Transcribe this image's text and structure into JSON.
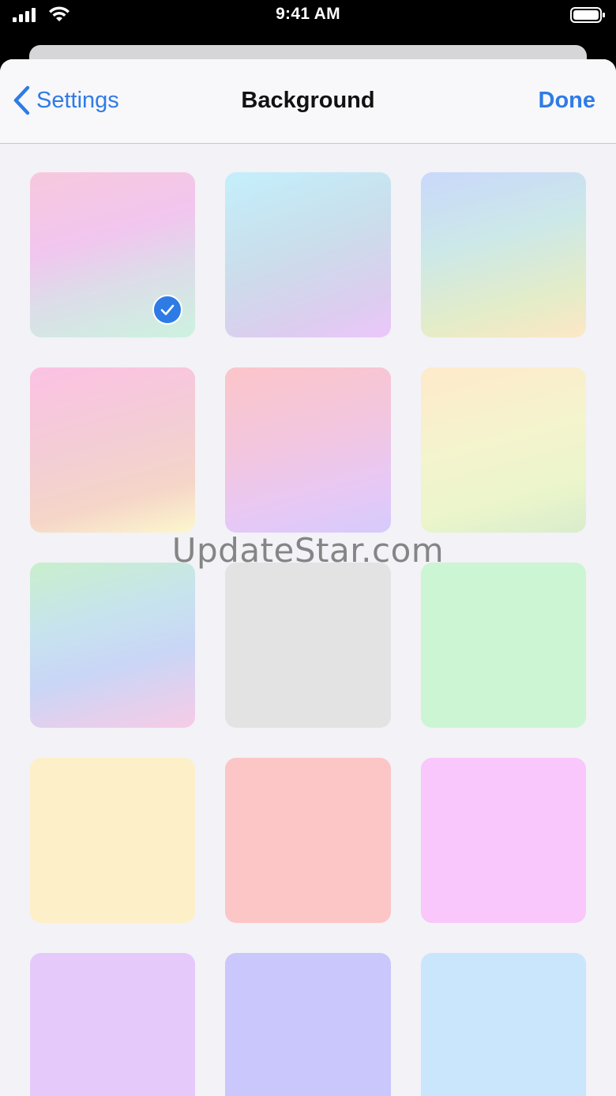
{
  "status_bar": {
    "time": "9:41 AM"
  },
  "nav": {
    "back_label": "Settings",
    "title": "Background",
    "done_label": "Done"
  },
  "accent_color": "#2f7be6",
  "swatches": [
    {
      "name": "gradient-pink-mint",
      "style": "linear-gradient(165deg, #f7c8dd 0%, #f1c6ef 40%, #dcdde8 65%, #cdf2df 100%)",
      "selected": true
    },
    {
      "name": "gradient-cyan-lavender",
      "style": "linear-gradient(160deg, #c4effc 0%, #cadeeb 45%, #dccdef 80%, #ecc6fb 100%)",
      "selected": false
    },
    {
      "name": "gradient-blue-yellow",
      "style": "linear-gradient(165deg, #c9d8fb 0%, #cce8e8 40%, #e3ecc8 75%, #fde7c5 100%)",
      "selected": false
    },
    {
      "name": "gradient-pink-cream",
      "style": "linear-gradient(165deg, #fcc2e3 0%, #f3cdd5 45%, #f5d5c8 75%, #fcf7cd 100%)",
      "selected": false
    },
    {
      "name": "gradient-peach-violet",
      "style": "linear-gradient(165deg, #fcc5c9 0%, #f2c6e0 45%, #e7c8f5 75%, #d5cbfb 100%)",
      "selected": false
    },
    {
      "name": "gradient-cream-green",
      "style": "linear-gradient(165deg, #feeacc 0%, #f4f4cd 45%, #ebf5cb 75%, #d8edcc 100%)",
      "selected": false
    },
    {
      "name": "gradient-green-pink",
      "style": "linear-gradient(165deg, #c8efcc 0%, #c7e3ee 35%, #c9d6f6 60%, #f7cbe6 100%)",
      "selected": false
    },
    {
      "name": "solid-gray",
      "style": "#e3e3e3",
      "selected": false
    },
    {
      "name": "solid-green",
      "style": "#ccf5d4",
      "selected": false
    },
    {
      "name": "solid-yellow",
      "style": "#fdf0c8",
      "selected": false
    },
    {
      "name": "solid-red",
      "style": "#fcc6c6",
      "selected": false
    },
    {
      "name": "solid-pink",
      "style": "#f9c7fb",
      "selected": false
    },
    {
      "name": "solid-purple",
      "style": "#e6c9fb",
      "selected": false
    },
    {
      "name": "solid-periwinkle",
      "style": "#c9c7fb",
      "selected": false
    },
    {
      "name": "solid-sky",
      "style": "#c9e6fc",
      "selected": false
    }
  ],
  "watermark": "UpdateStar.com"
}
